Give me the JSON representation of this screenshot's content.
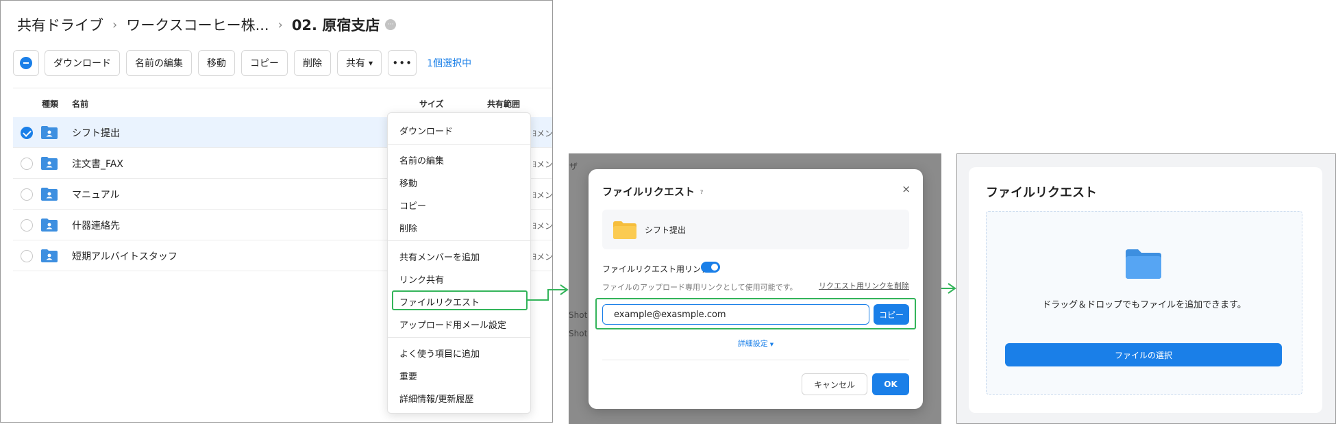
{
  "panel1": {
    "breadcrumb": [
      "共有ドライブ",
      "ワークスコーヒー株...",
      "02. 原宿支店"
    ],
    "breadcrumb_badge": "···",
    "toolbar": {
      "download": "ダウンロード",
      "rename": "名前の編集",
      "move": "移動",
      "copy": "コピー",
      "delete": "削除",
      "share": "共有",
      "more": "•••",
      "selected_count": "1個選択中"
    },
    "columns": [
      "種類",
      "名前",
      "サイズ",
      "共有範囲"
    ],
    "rows": [
      {
        "name": "シフト提出",
        "scope": "ﾖメン/",
        "selected": true
      },
      {
        "name": "注文書_FAX",
        "scope": "ﾖメン/",
        "selected": false
      },
      {
        "name": "マニュアル",
        "scope": "ﾖメン/",
        "selected": false
      },
      {
        "name": "什器連絡先",
        "scope": "ﾖメン/",
        "selected": false
      },
      {
        "name": "短期アルバイトスタッフ",
        "scope": "ﾖメン/",
        "selected": false
      }
    ],
    "context_menu": [
      "ダウンロード",
      "名前の編集",
      "移動",
      "コピー",
      "削除",
      "共有メンバーを追加",
      "リンク共有",
      "ファイルリクエスト",
      "アップロード用メール設定",
      "よく使う項目に追加",
      "重要",
      "詳細情報/更新履歴"
    ]
  },
  "panel2": {
    "background_text": [
      "ザ",
      "Shot",
      "Shot"
    ],
    "modal": {
      "title": "ファイルリクエスト",
      "help": "?",
      "close": "×",
      "file_name": "シフト提出",
      "link_label": "ファイルリクエスト用リンク",
      "link_enabled": true,
      "description": "ファイルのアップロード専用リンクとして使用可能です。",
      "delete_link": "リクエスト用リンクを削除",
      "email_value": "example@exasmple.com",
      "copy": "コピー",
      "detail": "詳細設定",
      "cancel": "キャンセル",
      "ok": "OK"
    }
  },
  "panel3": {
    "title": "ファイルリクエスト",
    "drop_text": "ドラッグ＆ドロップでもファイルを追加できます。",
    "select_button": "ファイルの選択"
  },
  "colors": {
    "accent": "#1a7fe8",
    "highlight": "#33b45a",
    "folder_blue": "#3d8fe0",
    "folder_yellow": "#f6be3c"
  }
}
